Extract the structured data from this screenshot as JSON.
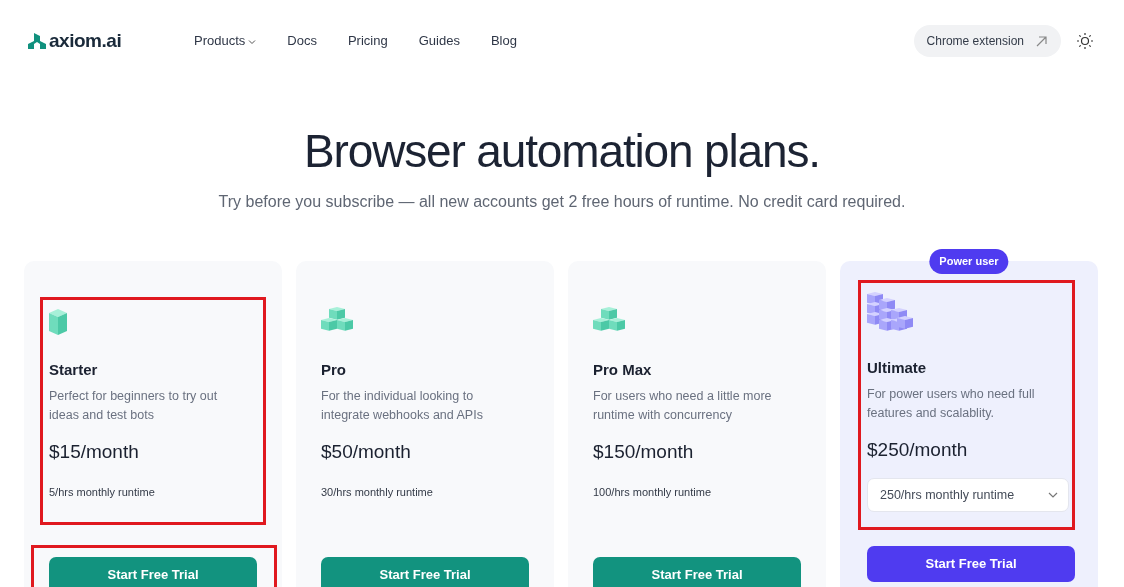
{
  "header": {
    "logo": "axiom.ai",
    "nav": [
      {
        "label": "Products",
        "dropdown": true
      },
      {
        "label": "Docs",
        "dropdown": false
      },
      {
        "label": "Pricing",
        "dropdown": false
      },
      {
        "label": "Guides",
        "dropdown": false
      },
      {
        "label": "Blog",
        "dropdown": false
      }
    ],
    "extension_button": "Chrome extension"
  },
  "hero": {
    "title": "Browser automation plans.",
    "subtitle": "Try before you subscribe — all new accounts get 2 free hours of runtime. No credit card required."
  },
  "plans": [
    {
      "kind": "single",
      "name": "Starter",
      "description": "Perfect for beginners to try out ideas and test bots",
      "price": "$15/month",
      "runtime": {
        "kind": "text",
        "label": "5/hrs monthly runtime"
      },
      "button": "Start Free Trial",
      "featured": false,
      "info_highlighted": true,
      "button_highlighted": true
    },
    {
      "kind": "triple",
      "name": "Pro",
      "description": "For the individual looking to integrate webhooks and APIs",
      "price": "$50/month",
      "runtime": {
        "kind": "text",
        "label": "30/hrs monthly runtime"
      },
      "button": "Start Free Trial",
      "featured": false,
      "info_highlighted": false,
      "button_highlighted": false
    },
    {
      "kind": "triple",
      "name": "Pro Max",
      "description": "For users who need a little more runtime with concurrency",
      "price": "$150/month",
      "runtime": {
        "kind": "text",
        "label": "100/hrs monthly runtime"
      },
      "button": "Start Free Trial",
      "featured": false,
      "info_highlighted": false,
      "button_highlighted": false
    },
    {
      "kind": "stairs",
      "badge": "Power user",
      "name": "Ultimate",
      "description": "For power users who need full features and scalablity.",
      "price": "$250/month",
      "runtime": {
        "kind": "select",
        "label": "250/hrs monthly runtime"
      },
      "button": "Start Free Trial",
      "featured": true,
      "info_highlighted": true,
      "button_highlighted": false
    }
  ]
}
